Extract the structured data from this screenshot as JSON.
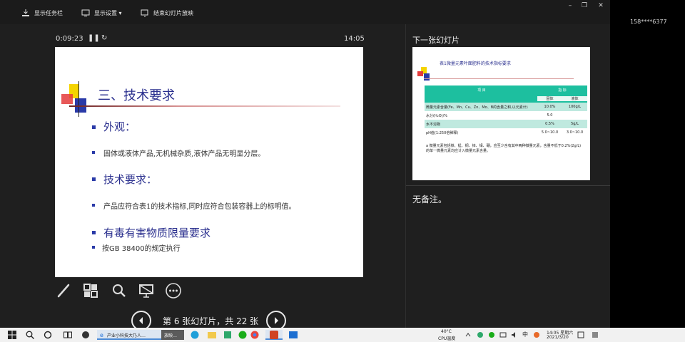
{
  "toolbar": {
    "show_taskbar_label": "显示任务栏",
    "display_settings_label": "显示设置 ▾",
    "end_show_label": "结束幻灯片放映"
  },
  "window_controls": {
    "minimize": "–",
    "restore": "❐",
    "close": "✕"
  },
  "outer": {
    "user": "158****6377"
  },
  "timer": {
    "elapsed": "0:09:23",
    "clock": "14:05"
  },
  "slide": {
    "title": "三、技术要求",
    "bullets": [
      {
        "text": "外观：",
        "level": 1
      },
      {
        "text": "固体或液体产品,无机械杂质,液体产品无明显分层。",
        "level": 2
      },
      {
        "text": "技术要求：",
        "level": 1
      },
      {
        "text": "产品应符合表1的技术指标,同时应符合包装容器上的标明值。",
        "level": 2
      },
      {
        "text": "有毒有害物质限量要求",
        "level": 1
      },
      {
        "text": "按GB 38400的规定执行",
        "level": 2
      }
    ]
  },
  "navigation": {
    "counter": "第 6 张幻灯片，共 22 张"
  },
  "next_slide": {
    "label": "下一张幻灯片",
    "table_title": "表1微量元素叶面肥料的技术指标要求",
    "header": {
      "item": "项 目",
      "indicator": "指 标"
    },
    "subheader": {
      "solid": "固体",
      "liquid": "液体"
    },
    "rows": [
      {
        "item": "微量元素含量(Fe、Mn、Cu、Zn、Mo、B的含量之和,以元素计)",
        "unit": "%",
        "solid": "10.0%",
        "liquid": "100g/L"
      },
      {
        "item": "水分(H₂O)/%",
        "unit": "≤",
        "solid": "5.0",
        "liquid": ""
      },
      {
        "item": "水不溶物",
        "unit": "≤",
        "solid": "0.5%",
        "liquid": "5g/L"
      },
      {
        "item": "pH值(1:250倍稀释)",
        "unit": "",
        "solid": "5.0~10.0",
        "liquid": "3.0~10.0"
      }
    ],
    "note": "a 微量元素包括铁、锰、铜、锌、钼、硼，应至少含有其中两种微量元素，含量不低于0.2%(2g/L)的单一微量元素均应计入微量元素含量。"
  },
  "notes": {
    "text": "无备注。"
  },
  "taskbar": {
    "app_label": "产业小科技大乃人…",
    "app2_label": "放映…",
    "weather": "40°C",
    "weather_sub": "CPU温度",
    "time": "14:05 星期六",
    "date": "2021/3/20",
    "ime": "中"
  },
  "colors": {
    "slide_title": "#2a2f8e",
    "bullet": "#2a3aa8",
    "table_header": "#1dbf9f",
    "table_alt_row": "#bfe9df",
    "ppt_icon": "#d04423"
  }
}
